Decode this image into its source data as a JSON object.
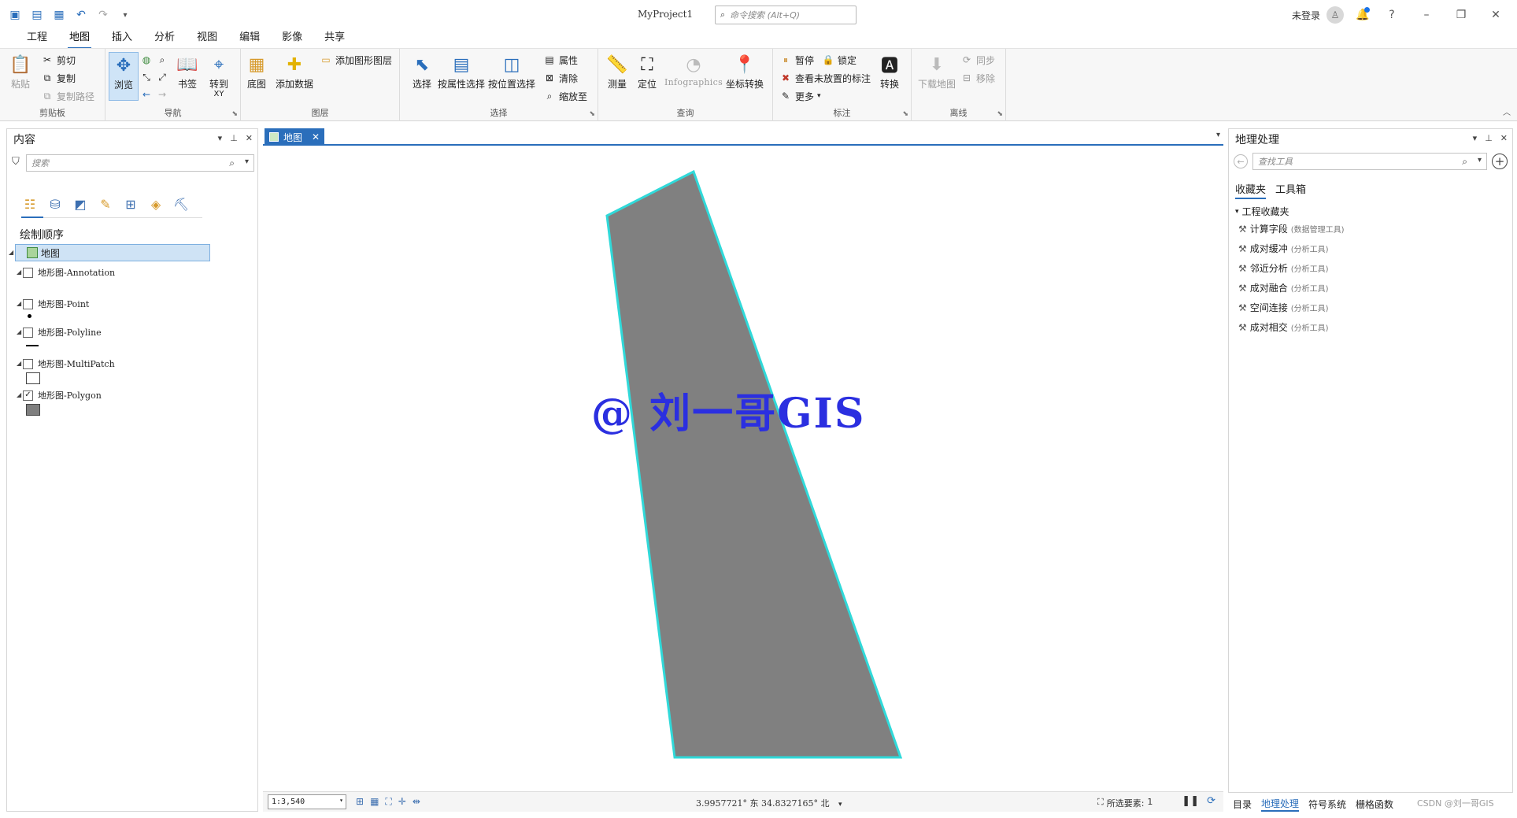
{
  "titlebar": {
    "project": "MyProject1",
    "search_placeholder": "命令搜索 (Alt+Q)",
    "login": "未登录"
  },
  "ribbon_tabs": [
    "工程",
    "地图",
    "插入",
    "分析",
    "视图",
    "编辑",
    "影像",
    "共享"
  ],
  "active_tab": "地图",
  "ribbon": {
    "clipboard": {
      "label": "剪贴板",
      "paste": "粘贴",
      "cut": "剪切",
      "copy": "复制",
      "copy_path": "复制路径"
    },
    "navigate": {
      "label": "导航",
      "explore": "浏览",
      "bookmarks": "书签",
      "goto": "转到",
      "goto_xy": "XY"
    },
    "layer": {
      "label": "图层",
      "basemap": "底图",
      "add_data": "添加数据",
      "add_graphics": "添加图形图层"
    },
    "selection": {
      "label": "选择",
      "select": "选择",
      "by_attr": "按属性选择",
      "by_loc": "按位置选择",
      "attributes": "属性",
      "clear": "清除",
      "zoom_to": "缩放至"
    },
    "inquiry": {
      "label": "查询",
      "measure": "测量",
      "locate": "定位",
      "infographics": "Infographics",
      "coord_conv": "坐标转换"
    },
    "labeling": {
      "label": "标注",
      "pause": "暂停",
      "lock": "锁定",
      "unplaced": "查看未放置的标注",
      "more": "更多",
      "convert": "转换"
    },
    "offline": {
      "label": "离线",
      "download": "下载地图",
      "sync": "同步",
      "remove": "移除"
    }
  },
  "contents": {
    "title": "内容",
    "search_placeholder": "搜索",
    "draw_order": "绘制顺序",
    "map_name": "地图",
    "layers": [
      {
        "name": "地形图-Annotation",
        "checked": false,
        "symbol": "none"
      },
      {
        "name": "地形图-Point",
        "checked": false,
        "symbol": "point"
      },
      {
        "name": "地形图-Polyline",
        "checked": false,
        "symbol": "line"
      },
      {
        "name": "地形图-MultiPatch",
        "checked": false,
        "symbol": "box"
      },
      {
        "name": "地形图-Polygon",
        "checked": true,
        "symbol": "polygon"
      }
    ]
  },
  "map_view": {
    "tab_label": "地图",
    "polygon_fill": "#808080",
    "polygon_outline": "#30d9d9",
    "watermark": "@ 刘一哥GIS",
    "watermark_color": "#2b2fe0",
    "scale": "1:3,540",
    "coords": "3.9957721° 东  34.8327165° 北",
    "selected_label": "所选要素:",
    "selected_count": "1"
  },
  "geoprocessing": {
    "title": "地理处理",
    "search_placeholder": "查找工具",
    "tab_favorites": "收藏夹",
    "tab_toolboxes": "工具箱",
    "folder": "工程收藏夹",
    "tools": [
      {
        "name": "计算字段",
        "toolbox": "(数据管理工具)"
      },
      {
        "name": "成对缓冲",
        "toolbox": "(分析工具)"
      },
      {
        "name": "邻近分析",
        "toolbox": "(分析工具)"
      },
      {
        "name": "成对融合",
        "toolbox": "(分析工具)"
      },
      {
        "name": "空间连接",
        "toolbox": "(分析工具)"
      },
      {
        "name": "成对相交",
        "toolbox": "(分析工具)"
      }
    ]
  },
  "bottom_tabs": [
    "目录",
    "地理处理",
    "符号系统",
    "栅格函数"
  ],
  "bottom_active": "地理处理",
  "credit": "CSDN @刘一哥GIS",
  "accent": "#2a6ebb"
}
